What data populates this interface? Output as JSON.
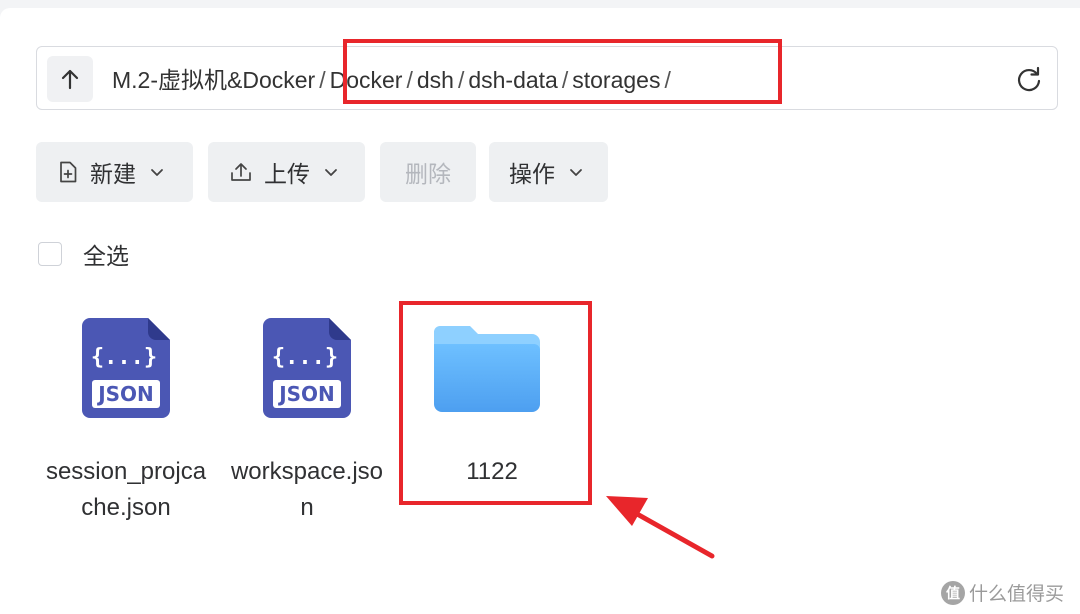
{
  "path_bar": {
    "segments": [
      "M.2-虚拟机&Docker",
      "Docker",
      "dsh",
      "dsh-data",
      "storages"
    ],
    "separator": "/"
  },
  "toolbar": {
    "new_label": "新建",
    "upload_label": "上传",
    "delete_label": "删除",
    "actions_label": "操作"
  },
  "select_all_label": "全选",
  "files": [
    {
      "type": "json",
      "name": "session_projcache.json",
      "icon_text": "{...}",
      "badge": "JSON"
    },
    {
      "type": "json",
      "name": "workspace.json",
      "icon_text": "{...}",
      "badge": "JSON"
    },
    {
      "type": "folder",
      "name": "1122"
    }
  ],
  "colors": {
    "annotation_red": "#e8262b",
    "json_icon": "#4a57b5",
    "folder_blue": "#5aaeff"
  },
  "watermark": {
    "logo": "值",
    "text": "什么值得买"
  }
}
